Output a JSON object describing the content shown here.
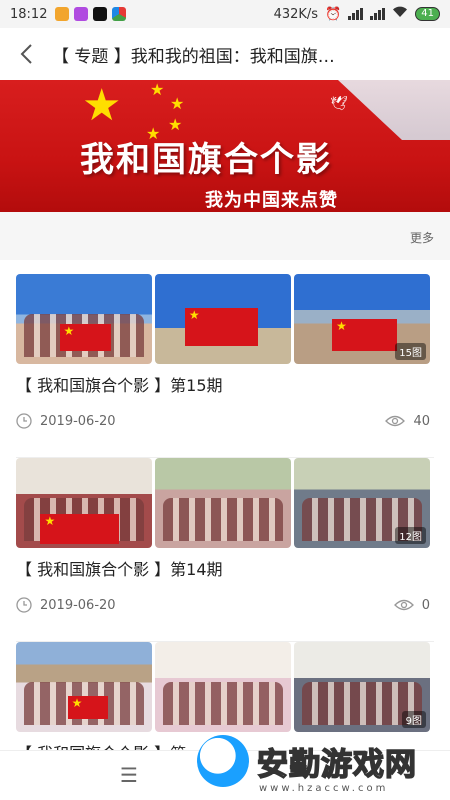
{
  "status_bar": {
    "time": "18:12",
    "speed": "432K/s",
    "battery": "41"
  },
  "nav": {
    "title": "【 专题 】我和我的祖国：我和国旗…"
  },
  "banner": {
    "slogan": "我和国旗合个影",
    "subtitle": "我为中国来点赞"
  },
  "section": {
    "more_label": "更多"
  },
  "articles": [
    {
      "title": "【 我和国旗合个影 】第15期",
      "date": "2019-06-20",
      "views": "40",
      "photo_count": "15图"
    },
    {
      "title": "【 我和国旗合个影 】第14期",
      "date": "2019-06-20",
      "views": "0",
      "photo_count": "12图"
    },
    {
      "title": "【 我和国旗合个影 】第",
      "photo_count": "9图"
    }
  ],
  "bottom_bar": {
    "menu_icon": "menu-icon"
  },
  "watermark": {
    "text": "安勤游戏网",
    "url": "www.hzaccw.com"
  },
  "colors": {
    "flag_red": "#d6141a",
    "star_yellow": "#ffde00"
  }
}
